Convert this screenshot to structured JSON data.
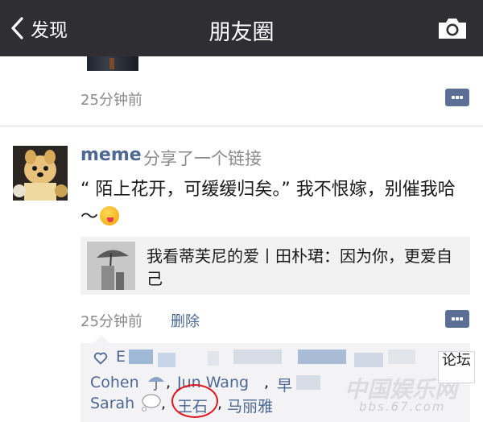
{
  "nav": {
    "back_label": "发现",
    "title": "朋友圈"
  },
  "prev_post": {
    "time": "25分钟前"
  },
  "post": {
    "username": "meme",
    "share_text": "分享了一个链接",
    "body": "“ 陌上花开，可缓缓归矣。” 我不恨嫁，别催我哈～",
    "emoji": "wink-tongue-emoji",
    "link_title": "我看蒂芙尼的爱丨田朴珺：因为你，更爱自己",
    "time": "25分钟前",
    "delete_label": "删除"
  },
  "likes": {
    "first_initial": "E",
    "names": [
      "Cohen",
      "Jun Wang",
      "早",
      "Sarah",
      "王石",
      "马丽雅"
    ],
    "separator": ","
  },
  "watermark": {
    "main": "中国娱乐网",
    "url": "bbs.67.com",
    "box_text": "论坛"
  },
  "colors": {
    "nav_bg": "#2e2e33",
    "link_blue": "#4d6893",
    "likes_bg": "#f3f3f5",
    "highlight_red": "#e0171c"
  }
}
